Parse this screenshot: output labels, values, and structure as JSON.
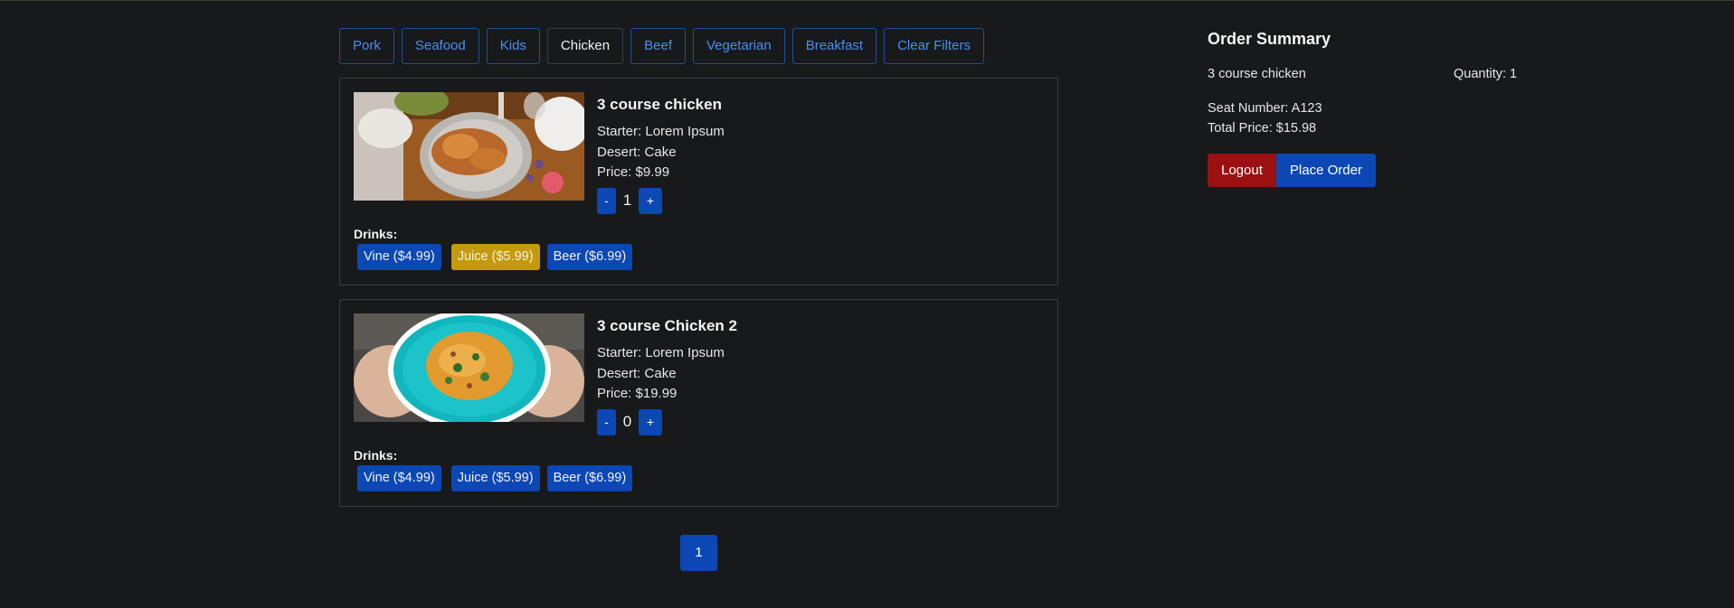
{
  "filters": [
    {
      "label": "Pork",
      "active": false
    },
    {
      "label": "Seafood",
      "active": false
    },
    {
      "label": "Kids",
      "active": false
    },
    {
      "label": "Chicken",
      "active": true
    },
    {
      "label": "Beef",
      "active": false
    },
    {
      "label": "Vegetarian",
      "active": false
    },
    {
      "label": "Breakfast",
      "active": false
    }
  ],
  "clear_filters_label": "Clear Filters",
  "meals": [
    {
      "title": "3 course chicken",
      "starter": "Starter: Lorem Ipsum",
      "desert": "Desert: Cake",
      "price": "Price: $9.99",
      "minus": "-",
      "plus": "+",
      "quantity": "1",
      "drinks_label": "Drinks:",
      "drinks": [
        "Vine ($4.99)",
        "Juice ($5.99)",
        "Beer ($6.99)"
      ],
      "selected_drink": "Juice ($5.99)"
    },
    {
      "title": "3 course Chicken 2",
      "starter": "Starter: Lorem Ipsum",
      "desert": "Desert: Cake",
      "price": "Price: $19.99",
      "minus": "-",
      "plus": "+",
      "quantity": "0",
      "drinks_label": "Drinks:",
      "drinks": [
        "Vine ($4.99)",
        "Juice ($5.99)",
        "Beer ($6.99)"
      ],
      "selected_drink": null
    }
  ],
  "pagination": {
    "current_page": "1"
  },
  "summary": {
    "title": "Order Summary",
    "item_name": "3 course chicken",
    "item_quantity": "Quantity: 1",
    "seat": "Seat Number: A123",
    "total": "Total Price: $15.98",
    "logout_label": "Logout",
    "place_order_label": "Place Order"
  },
  "colors": {
    "background": "#18191b",
    "primary": "#0b47b5",
    "link": "#4a8ef0",
    "warning": "#c49a0c",
    "danger": "#9b1111"
  }
}
